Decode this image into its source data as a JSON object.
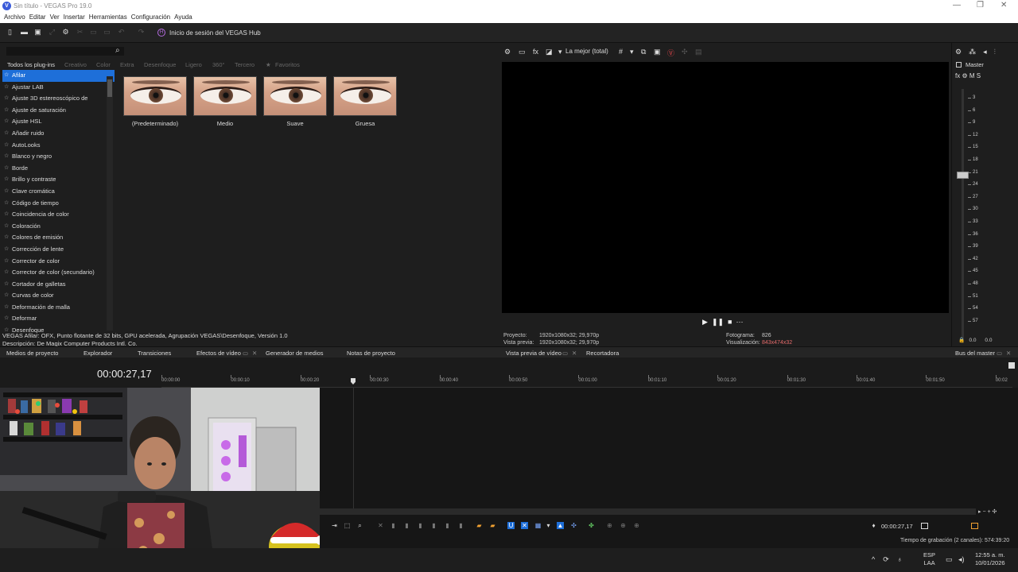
{
  "window": {
    "title": "Sin título - VEGAS Pro 19.0",
    "logo_letter": "V",
    "minimize": "—",
    "maximize": "❐",
    "close": "✕"
  },
  "menu": [
    "Archivo",
    "Editar",
    "Ver",
    "Insertar",
    "Herramientas",
    "Configuración",
    "Ayuda"
  ],
  "toolbar": {
    "hub_icon": "H",
    "hub_text": "Inicio de sesión del VEGAS Hub"
  },
  "browser": {
    "search_value": "",
    "categories": [
      "Todos los plug-ins",
      "Creativo",
      "Color",
      "Extra",
      "Desenfoque",
      "Ligero",
      "360°",
      "Tercero",
      "Favoritos"
    ],
    "effects": [
      "Afilar",
      "Ajustar LAB",
      "Ajuste 3D estereoscópico de",
      "Ajuste de saturación",
      "Ajuste HSL",
      "Añadir ruido",
      "AutoLooks",
      "Blanco y negro",
      "Borde",
      "Brillo y contraste",
      "Clave cromática",
      "Código de tiempo",
      "Coincidencia de color",
      "Coloración",
      "Colores de emisión",
      "Corrección de lente",
      "Corrector de color",
      "Corrector de color (secundario)",
      "Cortador de galletas",
      "Curvas de color",
      "Deformación de malla",
      "Deformar",
      "Desenfoque"
    ],
    "selected_effect": "Afilar",
    "presets": [
      "(Predeterminado)",
      "Medio",
      "Suave",
      "Gruesa"
    ],
    "status_line1": "VEGAS Afilar: OFX, Punto flotante de 32 bits, GPU acelerada, Agrupación VEGAS\\Desenfoque, Versión 1.0",
    "status_line2": "Descripción: De Magix Computer Products Intl. Co."
  },
  "preview": {
    "quality": "La mejor (total)",
    "project_label": "Proyecto:",
    "project_value": "1920x1080x32; 29,970p",
    "preview_label": "Vista previa:",
    "preview_value": "1920x1080x32; 29,970p",
    "frame_label": "Fotograma:",
    "frame_value": "826",
    "display_label": "Visualización:",
    "display_value": "843x474x32"
  },
  "master": {
    "label": "Master",
    "fx_row": "fx ⚙ M S",
    "scale": [
      "3",
      "6",
      "9",
      "12",
      "15",
      "18",
      "21",
      "24",
      "27",
      "30",
      "33",
      "36",
      "39",
      "42",
      "45",
      "48",
      "51",
      "54",
      "57"
    ],
    "bottom_left": "0.0",
    "bottom_right": "0.0"
  },
  "tabs": [
    "Medios de proyecto",
    "Explorador",
    "Transiciones",
    "Efectos de vídeo",
    "Generador de medios",
    "Notas de proyecto",
    "Vista previa de vídeo",
    "Recortadora",
    "Bus del master"
  ],
  "timeline": {
    "timecode": "00:00:27,17",
    "ruler": [
      "00:00:00",
      "00:00:10",
      "00:00:20",
      "00:00:30",
      "00:00:40",
      "00:00:50",
      "00:01:00",
      "00:01:10",
      "00:01:20",
      "00:01:30",
      "00:01:40",
      "00:01:50",
      "00:02"
    ],
    "cursor_time": "00:00:27,17",
    "record_status": "Tiempo de grabación (2 canales): 574:39:20"
  },
  "taskbar": {
    "lang1": "ESP",
    "lang2": "LAA",
    "time": "12:55 a. m.",
    "date": "10/01/2026"
  },
  "colors": {
    "accent": "#1e6fd9",
    "highlight": "#e36a6a"
  }
}
